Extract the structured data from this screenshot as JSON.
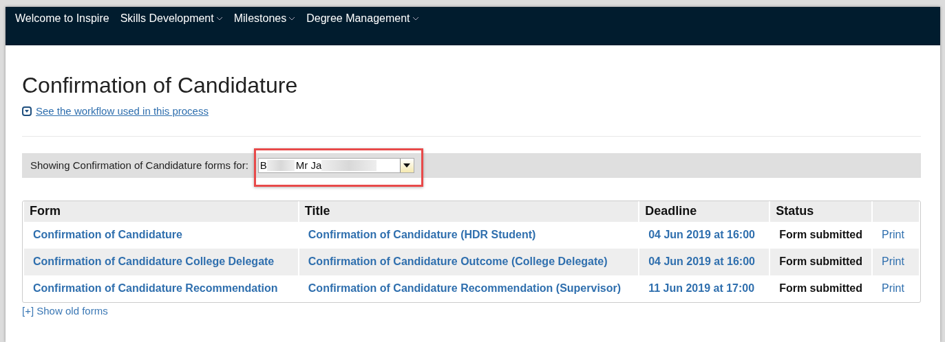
{
  "nav": {
    "items": [
      {
        "label": "Welcome to Inspire",
        "has_menu": false
      },
      {
        "label": "Skills Development",
        "has_menu": true
      },
      {
        "label": "Milestones",
        "has_menu": true
      },
      {
        "label": "Degree Management",
        "has_menu": true
      }
    ]
  },
  "page_title": "Confirmation of Candidature",
  "workflow_link": "See the workflow used in this process",
  "filter": {
    "label": "Showing Confirmation of Candidature forms for:",
    "value_parts": [
      "B",
      "Mr Ja"
    ],
    "highlighted": true
  },
  "table": {
    "columns": [
      "Form",
      "Title",
      "Deadline",
      "Status",
      ""
    ],
    "rows": [
      {
        "form": "Confirmation of Candidature",
        "title": "Confirmation of Candidature (HDR Student)",
        "deadline": "04 Jun 2019 at 16:00",
        "status": "Form submitted",
        "action": "Print"
      },
      {
        "form": "Confirmation of Candidature College Delegate",
        "title": "Confirmation of Candidature Outcome (College Delegate)",
        "deadline": "04 Jun 2019 at 16:00",
        "status": "Form submitted",
        "action": "Print"
      },
      {
        "form": "Confirmation of Candidature Recommendation",
        "title": "Confirmation of Candidature Recommendation (Supervisor)",
        "deadline": "11 Jun 2019 at 17:00",
        "status": "Form submitted",
        "action": "Print"
      }
    ]
  },
  "show_old_link": "[+] Show old forms"
}
